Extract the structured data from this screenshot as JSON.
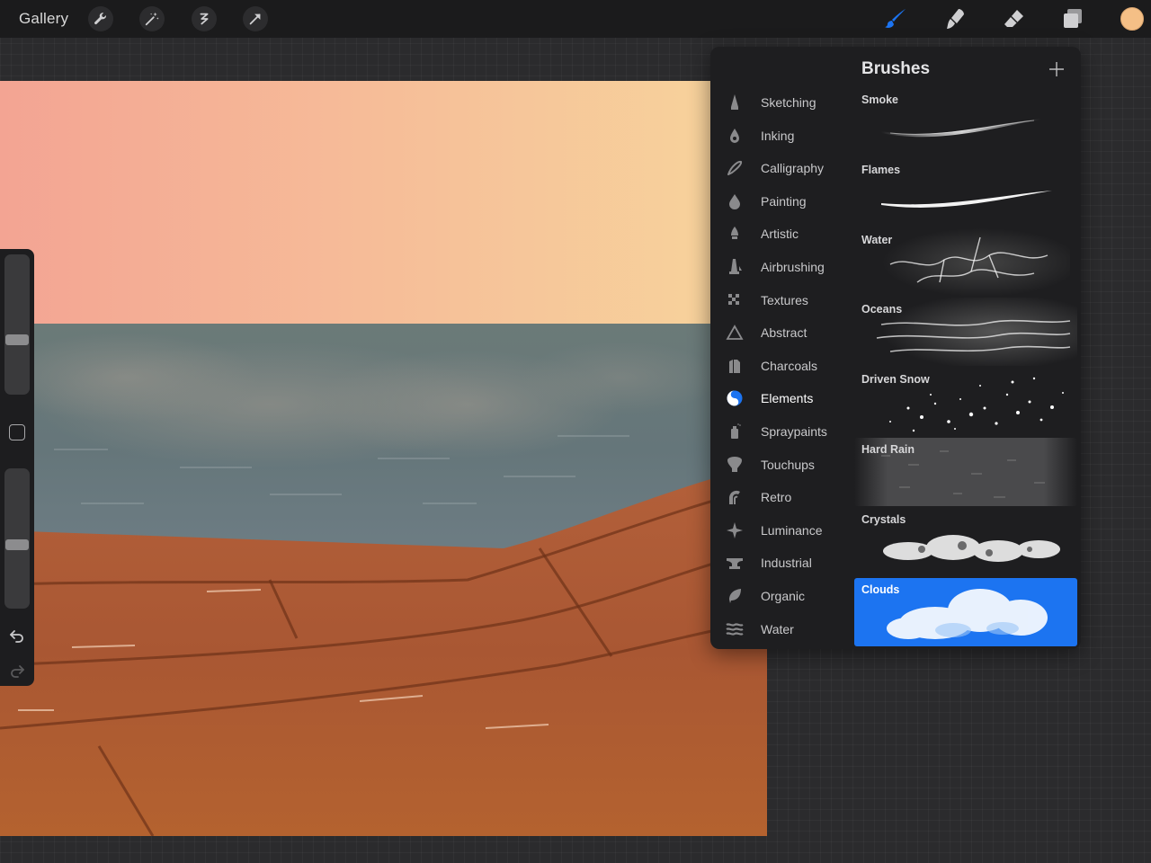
{
  "topbar": {
    "gallery_label": "Gallery",
    "actions": [
      "wrench-icon",
      "magic-wand-icon",
      "selection-icon",
      "transform-icon"
    ],
    "tools": [
      "brush-icon",
      "smudge-icon",
      "eraser-icon",
      "layers-icon"
    ],
    "current_color": "#f4bf86",
    "active_tool_color": "#1c74f1"
  },
  "brushes_panel": {
    "title": "Brushes",
    "categories": [
      {
        "label": "Sketching",
        "icon": "pencil-icon"
      },
      {
        "label": "Inking",
        "icon": "ink-drop-icon"
      },
      {
        "label": "Calligraphy",
        "icon": "calligraphy-icon"
      },
      {
        "label": "Painting",
        "icon": "paint-drop-icon"
      },
      {
        "label": "Artistic",
        "icon": "artistic-brush-icon"
      },
      {
        "label": "Airbrushing",
        "icon": "airbrush-icon"
      },
      {
        "label": "Textures",
        "icon": "checker-icon"
      },
      {
        "label": "Abstract",
        "icon": "triangle-icon"
      },
      {
        "label": "Charcoals",
        "icon": "charcoal-icon"
      },
      {
        "label": "Elements",
        "icon": "yin-yang-icon"
      },
      {
        "label": "Spraypaints",
        "icon": "spray-can-icon"
      },
      {
        "label": "Touchups",
        "icon": "touchup-icon"
      },
      {
        "label": "Retro",
        "icon": "retro-icon"
      },
      {
        "label": "Luminance",
        "icon": "sparkle-icon"
      },
      {
        "label": "Industrial",
        "icon": "anvil-icon"
      },
      {
        "label": "Organic",
        "icon": "leaf-icon"
      },
      {
        "label": "Water",
        "icon": "waves-icon"
      }
    ],
    "active_category": "Elements",
    "brushes": [
      {
        "name": "Smoke"
      },
      {
        "name": "Flames"
      },
      {
        "name": "Water"
      },
      {
        "name": "Oceans"
      },
      {
        "name": "Driven Snow"
      },
      {
        "name": "Hard Rain"
      },
      {
        "name": "Crystals"
      },
      {
        "name": "Clouds"
      }
    ],
    "selected_brush": "Clouds"
  },
  "sidebar": {
    "brush_size_level": 0.38,
    "opacity_level": 0.45
  }
}
